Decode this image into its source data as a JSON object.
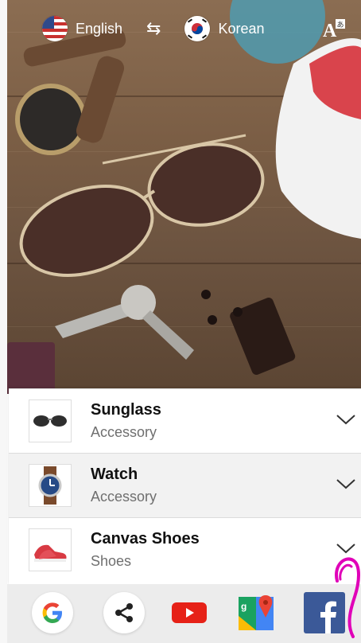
{
  "topbar": {
    "source_lang": "English",
    "target_lang": "Korean",
    "swap_icon": "swap-arrows-icon",
    "translate_icon": "text-translate-icon"
  },
  "results": [
    {
      "title": "Sunglass",
      "category": "Accessory",
      "thumb_icon": "sunglasses-thumbnail"
    },
    {
      "title": "Watch",
      "category": "Accessory",
      "thumb_icon": "watch-thumbnail"
    },
    {
      "title": "Canvas Shoes",
      "category": "Shoes",
      "thumb_icon": "sneakers-thumbnail"
    }
  ],
  "dock": {
    "apps": [
      "google-icon",
      "share-icon",
      "youtube-icon",
      "google-maps-icon",
      "facebook-icon"
    ]
  },
  "colors": {
    "gesture": "#e000b8",
    "youtube": "#e62117",
    "facebook": "#3b5998",
    "row_alt_bg": "#f2f2f2"
  }
}
